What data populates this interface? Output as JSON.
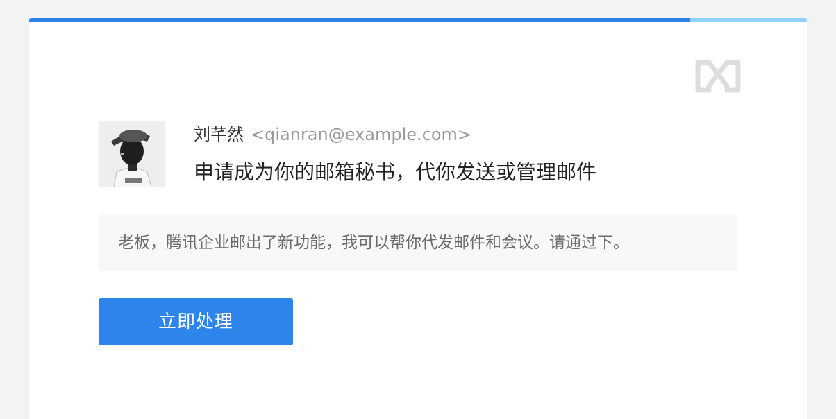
{
  "progress": 0.85,
  "logo": {
    "icon": "brand-logo-icon",
    "color": "#dddddd"
  },
  "sender": {
    "name": "刘芊然",
    "email": "<qianran@example.com>"
  },
  "subject": "申请成为你的邮箱秘书，代你发送或管理邮件",
  "message": "老板，腾讯企业邮出了新功能，我可以帮你代发邮件和会议。请通过下。",
  "action_button_label": "立即处理",
  "colors": {
    "accent": "#2d84ea",
    "progress_track": "#8fd3f8",
    "background": "#f3f3f3"
  }
}
